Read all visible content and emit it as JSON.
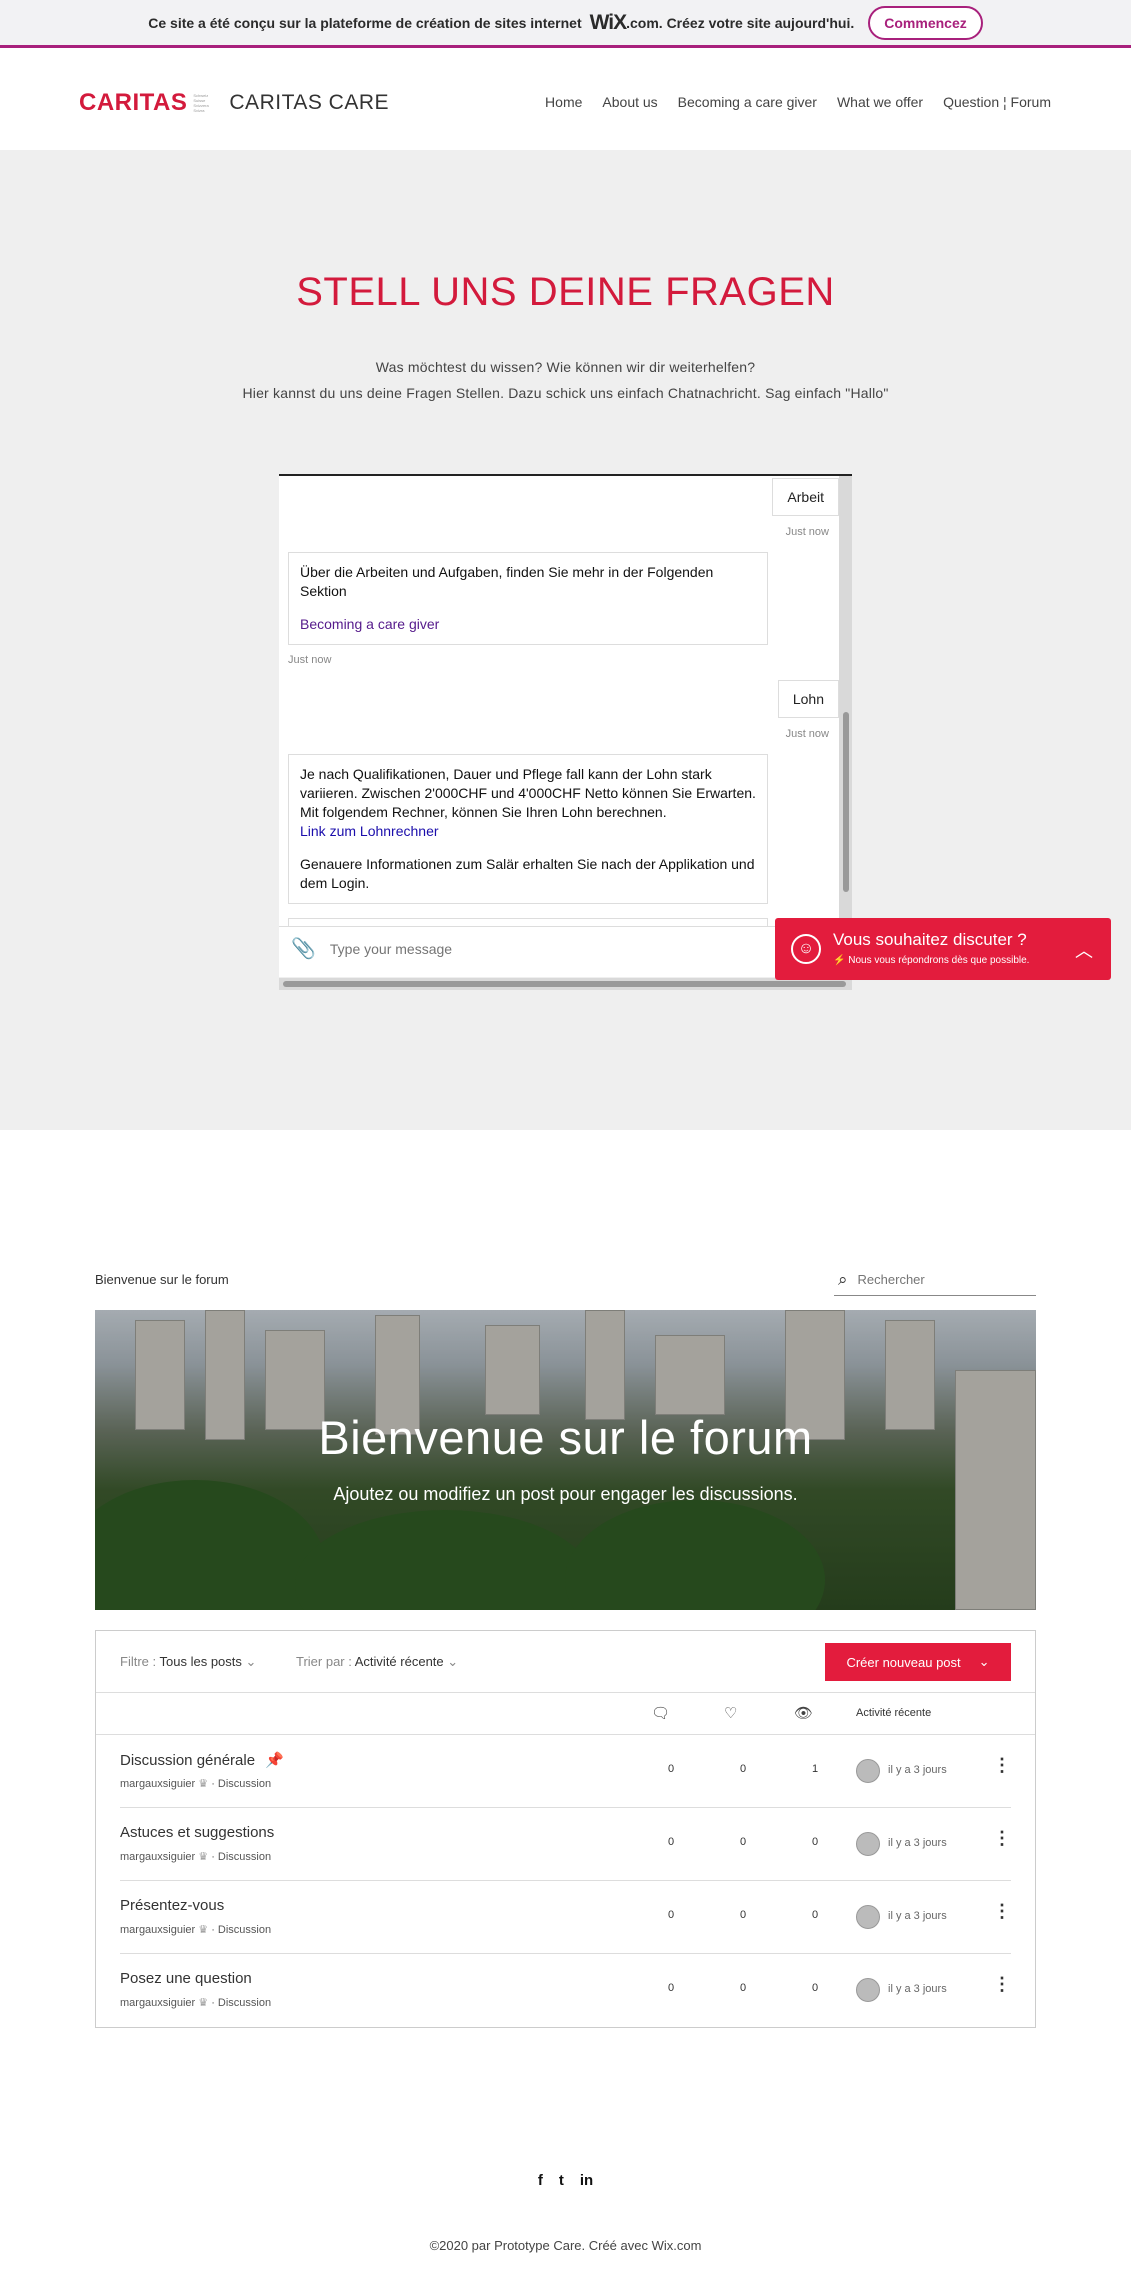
{
  "wixbar": {
    "message": "Ce site a été conçu sur la plateforme de création de sites internet",
    "brand": "WiX",
    "domain": ".com. Créez votre site aujourd'hui.",
    "cta": "Commencez"
  },
  "header": {
    "logo_mark": "CARITAS",
    "logo_sub": "Schweiz Suisse Svizzera Svizra",
    "site_name": "CARITAS CARE",
    "nav": [
      "Home",
      "About us",
      "Becoming a care giver",
      "What we offer",
      "Question ¦ Forum"
    ]
  },
  "hero": {
    "title": "STELL UNS DEINE FRAGEN",
    "line1": "Was möchtest du wissen? Wie können wir dir weiterhelfen?",
    "line2": "Hier kannst du uns deine Fragen Stellen. Dazu schick uns einfach Chatnachricht. Sag einfach \"Hallo\""
  },
  "chat": {
    "msg1": "Arbeit",
    "msg1_time": "Just now",
    "bot1_text": "Über die Arbeiten und Aufgaben, finden Sie mehr in der Folgenden Sektion",
    "bot1_link": "Becoming a care giver",
    "bot1_time": "Just now",
    "msg2": "Lohn",
    "msg2_time": "Just now",
    "bot2_text": "Je nach Qualifikationen, Dauer und Pflege fall kann der Lohn stark variieren. Zwischen 2'000CHF und 4'000CHF Netto können Sie Erwarten. Mit folgendem Rechner, können Sie Ihren Lohn berechnen.",
    "bot2_link": "Link zum Lohnrechner",
    "bot2_text2": "Genauere Informationen zum Salär erhalten Sie nach der Applikation und dem Login.",
    "placeholder": "Type your message"
  },
  "widget": {
    "title": "Vous souhaitez discuter ?",
    "subtitle": "Nous vous répondrons dès que possible."
  },
  "forum": {
    "breadcrumb": "Bienvenue sur le forum",
    "search_placeholder": "Rechercher",
    "banner_title": "Bienvenue sur le forum",
    "banner_subtitle": "Ajoutez ou modifiez un post pour engager les discussions.",
    "filter_label": "Filtre :",
    "filter_value": "Tous les posts",
    "sort_label": "Trier par :",
    "sort_value": "Activité récente",
    "new_post": "Créer nouveau post",
    "recent_col": "Activité récente",
    "rows": [
      {
        "name": "Discussion générale",
        "author": "margauxsiguier",
        "category": "Discussion",
        "comments": "0",
        "likes": "0",
        "views": "1",
        "when": "il y a 3 jours"
      },
      {
        "name": "Astuces et suggestions",
        "author": "margauxsiguier",
        "category": "Discussion",
        "comments": "0",
        "likes": "0",
        "views": "0",
        "when": "il y a 3 jours"
      },
      {
        "name": "Présentez-vous",
        "author": "margauxsiguier",
        "category": "Discussion",
        "comments": "0",
        "likes": "0",
        "views": "0",
        "when": "il y a 3 jours"
      },
      {
        "name": "Posez une question",
        "author": "margauxsiguier",
        "category": "Discussion",
        "comments": "0",
        "likes": "0",
        "views": "0",
        "when": "il y a 3 jours"
      }
    ]
  },
  "social": [
    "f",
    "t",
    "in"
  ],
  "footer": "©2020 par Prototype Care. Créé avec Wix.com",
  "colors": {
    "accent": "#e31c3d",
    "brand": "#d31a3c",
    "wix": "#a8207c",
    "hero_bg": "#efefef"
  }
}
